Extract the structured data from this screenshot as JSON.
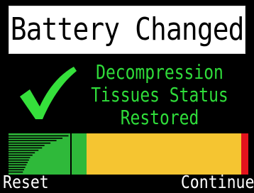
{
  "screen": {
    "title": "Battery Changed",
    "message_lines": [
      "Decompression",
      "Tissues Status",
      "Restored"
    ],
    "icon": "checkmark-icon"
  },
  "tissue_bar": {
    "zones": [
      {
        "color": "#2fb93a",
        "label": ""
      },
      {
        "color": "#f5c531",
        "label": ""
      },
      {
        "color": "#e3131d",
        "label": ""
      }
    ],
    "tissue_levels": [
      0.5,
      0.45,
      0.4,
      0.35,
      0.3,
      0.28,
      0.25,
      0.22,
      0.2,
      0.18,
      0.17,
      0.16,
      0.15,
      0.14,
      0.13,
      0.12
    ]
  },
  "footer": {
    "reset_label": "Reset",
    "continue_label": "Continue"
  },
  "colors": {
    "background": "#000000",
    "title_bg": "#ffffff",
    "message_text": "#2fdc3a",
    "check": "#35e03b",
    "footer_text": "#ffffff"
  }
}
